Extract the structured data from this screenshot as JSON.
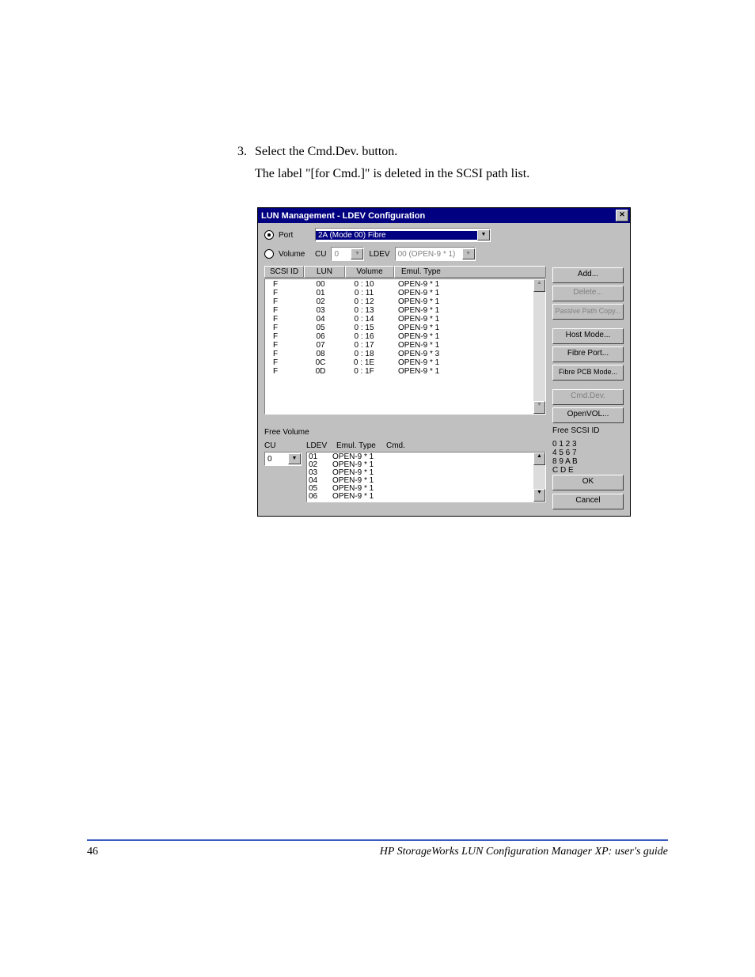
{
  "instruction": {
    "number": "3.",
    "line1": "Select the Cmd.Dev. button.",
    "line2": "The label \"[for Cmd.]\" is deleted in the SCSI path list."
  },
  "dialog": {
    "title": "LUN Management - LDEV Configuration",
    "port_label": "Port",
    "volume_label": "Volume",
    "port_value": "2A (Mode 00) Fibre",
    "cu_label": "CU",
    "cu_value": "0",
    "ldev_label": "LDEV",
    "ldev_value": "00 (OPEN-9 * 1)",
    "headers": {
      "scsi": "SCSI ID",
      "lun": "LUN",
      "volume": "Volume",
      "emul": "Emul. Type"
    },
    "rows": [
      {
        "scsi": "F",
        "lun": "00",
        "vol": "0 : 10",
        "emul": "OPEN-9 * 1"
      },
      {
        "scsi": "F",
        "lun": "01",
        "vol": "0 : 11",
        "emul": "OPEN-9 * 1"
      },
      {
        "scsi": "F",
        "lun": "02",
        "vol": "0 : 12",
        "emul": "OPEN-9 * 1"
      },
      {
        "scsi": "F",
        "lun": "03",
        "vol": "0 : 13",
        "emul": "OPEN-9 * 1"
      },
      {
        "scsi": "F",
        "lun": "04",
        "vol": "0 : 14",
        "emul": "OPEN-9 * 1"
      },
      {
        "scsi": "F",
        "lun": "05",
        "vol": "0 : 15",
        "emul": "OPEN-9 * 1"
      },
      {
        "scsi": "F",
        "lun": "06",
        "vol": "0 : 16",
        "emul": "OPEN-9 * 1"
      },
      {
        "scsi": "F",
        "lun": "07",
        "vol": "0 : 17",
        "emul": "OPEN-9 * 1"
      },
      {
        "scsi": "F",
        "lun": "08",
        "vol": "0 : 18",
        "emul": "OPEN-9 * 3"
      },
      {
        "scsi": "F",
        "lun": "0C",
        "vol": "0 : 1E",
        "emul": "OPEN-9 * 1"
      },
      {
        "scsi": "F",
        "lun": "0D",
        "vol": "0 : 1F",
        "emul": "OPEN-9 * 1"
      }
    ],
    "buttons": {
      "add": "Add...",
      "delete": "Delete...",
      "passive": "Passive Path Copy...",
      "hostmode": "Host Mode...",
      "fibreport": "Fibre Port...",
      "fibrepcb": "Fibre PCB Mode...",
      "cmddev": "Cmd.Dev.",
      "openvol": "OpenVOL..."
    },
    "freevol": {
      "title": "Free Volume",
      "cu_label": "CU",
      "ldev_label": "LDEV",
      "emul_label": "Emul. Type",
      "cmd_label": "Cmd.",
      "cu_value": "0",
      "rows": [
        {
          "ldev": "01",
          "emul": "OPEN-9 * 1",
          "cmd": ""
        },
        {
          "ldev": "02",
          "emul": "OPEN-9 * 1",
          "cmd": ""
        },
        {
          "ldev": "03",
          "emul": "OPEN-9 * 1",
          "cmd": ""
        },
        {
          "ldev": "04",
          "emul": "OPEN-9 * 1",
          "cmd": ""
        },
        {
          "ldev": "05",
          "emul": "OPEN-9 * 1",
          "cmd": ""
        },
        {
          "ldev": "06",
          "emul": "OPEN-9 * 1",
          "cmd": ""
        }
      ]
    },
    "freesci": {
      "title": "Free SCSI ID",
      "row1": "0  1  2  3",
      "row2": "4  5  6  7",
      "row3": "8  9  A  B",
      "row4": "C  D  E"
    },
    "ok": "OK",
    "cancel": "Cancel"
  },
  "footer": {
    "page": "46",
    "title": "HP StorageWorks LUN Configuration Manager XP: user's guide"
  }
}
